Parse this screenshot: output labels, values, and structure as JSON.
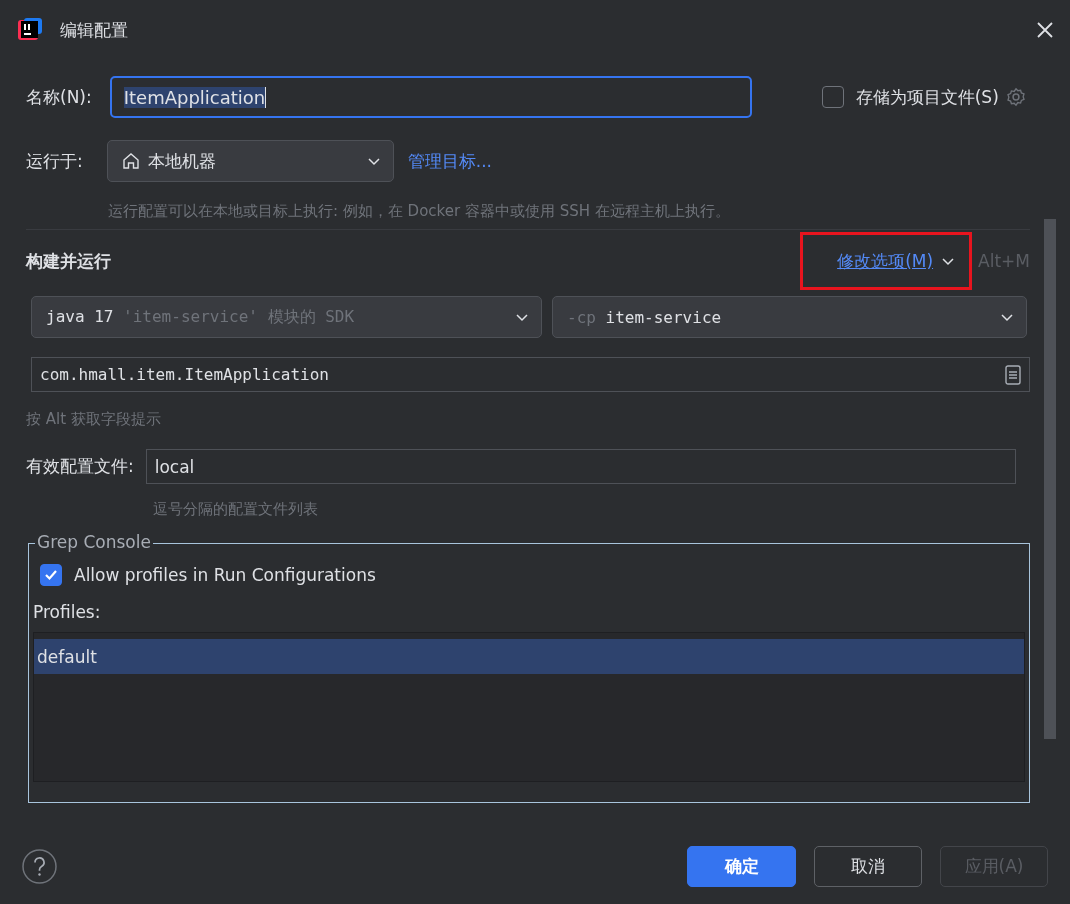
{
  "window": {
    "title": "编辑配置"
  },
  "name_row": {
    "label": "名称(N):",
    "value": "ItemApplication",
    "text_selected": true,
    "focused": true
  },
  "store_as_project_file": {
    "label": "存储为项目文件(S)",
    "checked": false
  },
  "run_on": {
    "label": "运行于:",
    "value": "本地机器",
    "link": "管理目标...",
    "hint": "运行配置可以在本地或目标上执行: 例如，在 Docker 容器中或使用 SSH 在远程主机上执行。"
  },
  "build_and_run": {
    "title": "构建并运行",
    "modify_options": {
      "label": "修改选项(M)",
      "highlighted": true
    },
    "shortcut": "Alt+M",
    "sdk": {
      "main": "java 17",
      "detail": "'item-service' 模块的 SDK"
    },
    "classpath": {
      "prefix": "-cp",
      "module": "item-service"
    },
    "main_class": "com.hmall.item.ItemApplication",
    "hint": "按 Alt 获取字段提示"
  },
  "active_profiles": {
    "label": "有效配置文件:",
    "value": "local",
    "hint": "逗号分隔的配置文件列表"
  },
  "grep_console": {
    "title": "Grep Console",
    "allow_profiles": {
      "label": "Allow profiles in Run Configurations",
      "checked": true
    },
    "profiles_label": "Profiles:",
    "profiles": [
      {
        "name": "default",
        "selected": true
      }
    ]
  },
  "buttons": [
    {
      "label": "确定",
      "kind": "primary",
      "disabled": false
    },
    {
      "label": "取消",
      "kind": "normal",
      "disabled": false
    },
    {
      "label": "应用(A)",
      "kind": "normal",
      "disabled": true
    }
  ]
}
